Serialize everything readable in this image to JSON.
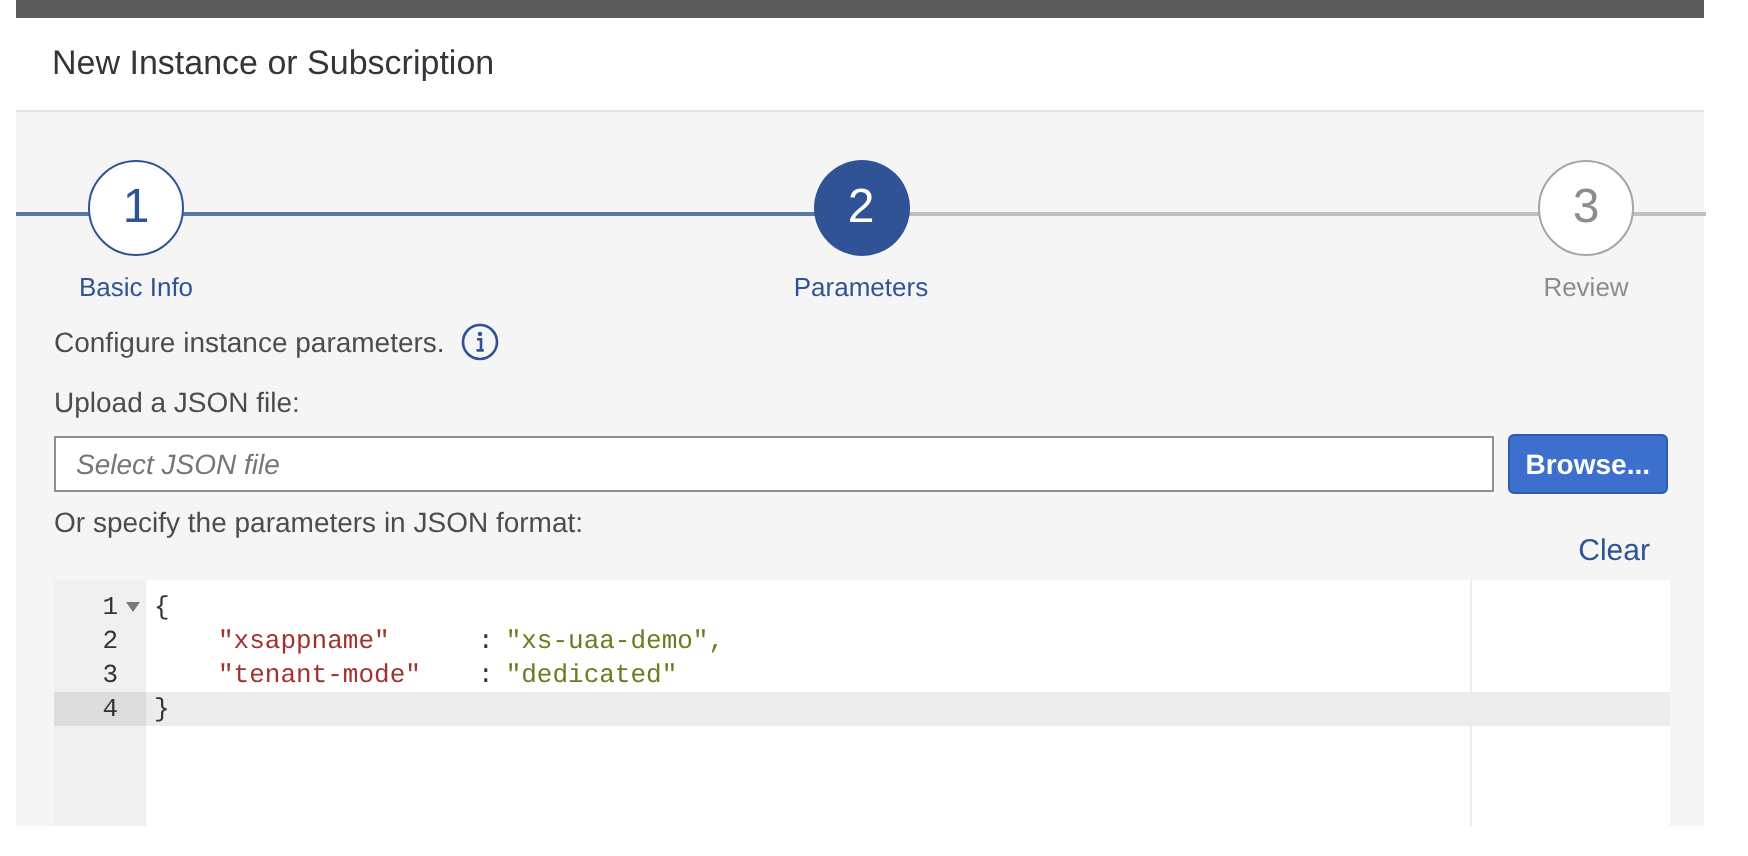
{
  "dialog": {
    "title": "New Instance or Subscription"
  },
  "steps": [
    {
      "number": "1",
      "label": "Basic Info",
      "completed": true,
      "selected": false
    },
    {
      "number": "2",
      "label": "Parameters",
      "completed": false,
      "selected": true
    },
    {
      "number": "3",
      "label": "Review",
      "completed": false,
      "selected": false
    }
  ],
  "intro": {
    "text": "Configure instance parameters."
  },
  "upload": {
    "label": "Upload a JSON file:",
    "placeholder": "Select JSON file",
    "button": "Browse..."
  },
  "editor_label": "Or specify the parameters in JSON format:",
  "clear_link": "Clear",
  "editor": {
    "lines": [
      {
        "number": "1",
        "foldable": true,
        "active": false,
        "tokens": [
          {
            "kind": "punct",
            "text": "{"
          }
        ]
      },
      {
        "number": "2",
        "foldable": false,
        "active": false,
        "tokens": [
          {
            "kind": "key",
            "text": "\"xsappname\""
          },
          {
            "kind": "punct",
            "text": ":"
          },
          {
            "kind": "string",
            "text": "\"xs-uaa-demo\","
          }
        ]
      },
      {
        "number": "3",
        "foldable": false,
        "active": false,
        "tokens": [
          {
            "kind": "key",
            "text": "\"tenant-mode\""
          },
          {
            "kind": "punct",
            "text": ":"
          },
          {
            "kind": "string",
            "text": "\"dedicated\""
          }
        ]
      },
      {
        "number": "4",
        "foldable": false,
        "active": true,
        "tokens": [
          {
            "kind": "punct",
            "text": "}"
          }
        ]
      }
    ]
  }
}
